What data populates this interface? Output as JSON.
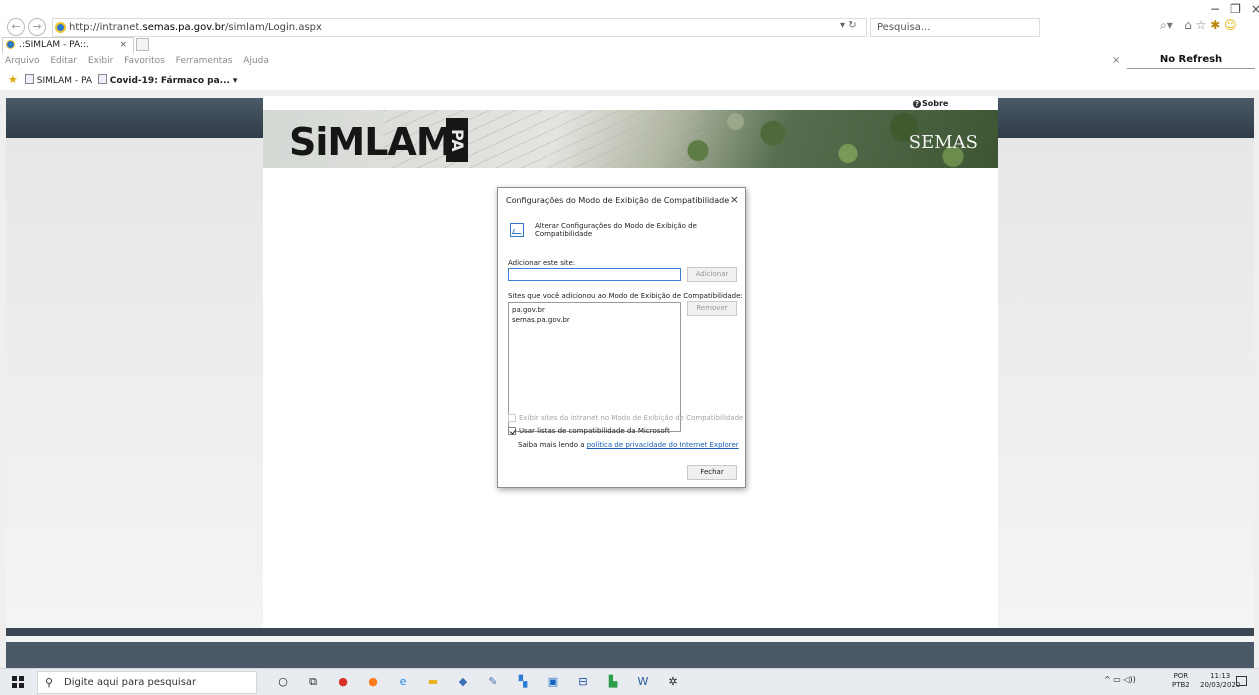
{
  "browser": {
    "address": {
      "prefix": "http://intranet.",
      "host": "semas.pa.gov.br",
      "path": "/simlam/Login.aspx"
    },
    "address_controls": "▾ ↻",
    "search_placeholder": "Pesquisa...",
    "window_controls": {
      "minimize": "−",
      "maximize": "❐",
      "close": "×"
    },
    "tab": {
      "title": ".:SIMLAM - PA::.",
      "close": "×"
    },
    "menu": [
      "Arquivo",
      "Editar",
      "Exibir",
      "Favoritos",
      "Ferramentas",
      "Ajuda"
    ],
    "menu_close": "×",
    "no_refresh": "No Refresh",
    "favorites": [
      {
        "label": "SIMLAM - PA",
        "bold": false
      },
      {
        "label": "Covid-19: Fármaco pa...",
        "bold": true
      }
    ],
    "favorites_dropdown": "▾",
    "icons": {
      "search": "⌕",
      "home": "⌂",
      "favorites": "☆",
      "settings": "✱",
      "feedback": "☺"
    }
  },
  "site": {
    "logo_text": "SiMLAM",
    "logo_suffix": "PA",
    "agency": "SEMAS",
    "sobre_label": "Sobre"
  },
  "dialog": {
    "title": "Configurações do Modo de Exibição de Compatibilidade",
    "close": "×",
    "heading": "Alterar Configurações do Modo de Exibição de Compatibilidade",
    "add_label": "Adicionar este site:",
    "add_input_value": "",
    "add_button": "Adicionar",
    "sites_label": "Sites que você adicionou ao Modo de Exibição de Compatibilidade:",
    "sites": [
      "pa.gov.br",
      "semas.pa.gov.br"
    ],
    "remove_button": "Remover",
    "intranet_checkbox": {
      "label": "Exibir sites da intranet no Modo de Exibição de Compatibilidade",
      "checked": false,
      "enabled": false
    },
    "microsoft_checkbox": {
      "label": "Usar listas de compatibilidade da Microsoft",
      "checked": true
    },
    "more_text": "Saiba mais lendo a ",
    "privacy_link": "política de privacidade do Internet Explorer",
    "close_button": "Fechar"
  },
  "taskbar": {
    "search_placeholder": "Digite aqui para pesquisar",
    "apps": [
      {
        "name": "cortana-icon",
        "glyph": "○",
        "color": "#222222"
      },
      {
        "name": "task-view-icon",
        "glyph": "⧉",
        "color": "#222222"
      },
      {
        "name": "chrome-icon",
        "glyph": "●",
        "color": "#d93025"
      },
      {
        "name": "firefox-icon",
        "glyph": "●",
        "color": "#ff7a1a"
      },
      {
        "name": "internet-explorer-icon",
        "glyph": "e",
        "color": "#1e88e5"
      },
      {
        "name": "file-explorer-icon",
        "glyph": "▬",
        "color": "#e6b422"
      },
      {
        "name": "teams-icon",
        "glyph": "◆",
        "color": "#3b6fb6"
      },
      {
        "name": "paint-icon",
        "glyph": "✎",
        "color": "#4a78b0"
      },
      {
        "name": "app-icon",
        "glyph": "▚",
        "color": "#2e7bd6"
      },
      {
        "name": "photos-icon",
        "glyph": "▣",
        "color": "#1565c0"
      },
      {
        "name": "calculator-icon",
        "glyph": "⊟",
        "color": "#1a4fa0"
      },
      {
        "name": "green-app-icon",
        "glyph": "▙",
        "color": "#2e9e4a"
      },
      {
        "name": "word-icon",
        "glyph": "W",
        "color": "#2b579a"
      },
      {
        "name": "settings-icon",
        "glyph": "✲",
        "color": "#222222"
      }
    ],
    "tray_icons": "^ ▭ ◁))",
    "lang_top": "POR",
    "lang_bottom": "PTB2",
    "time": "11:13",
    "date": "20/03/2020"
  }
}
